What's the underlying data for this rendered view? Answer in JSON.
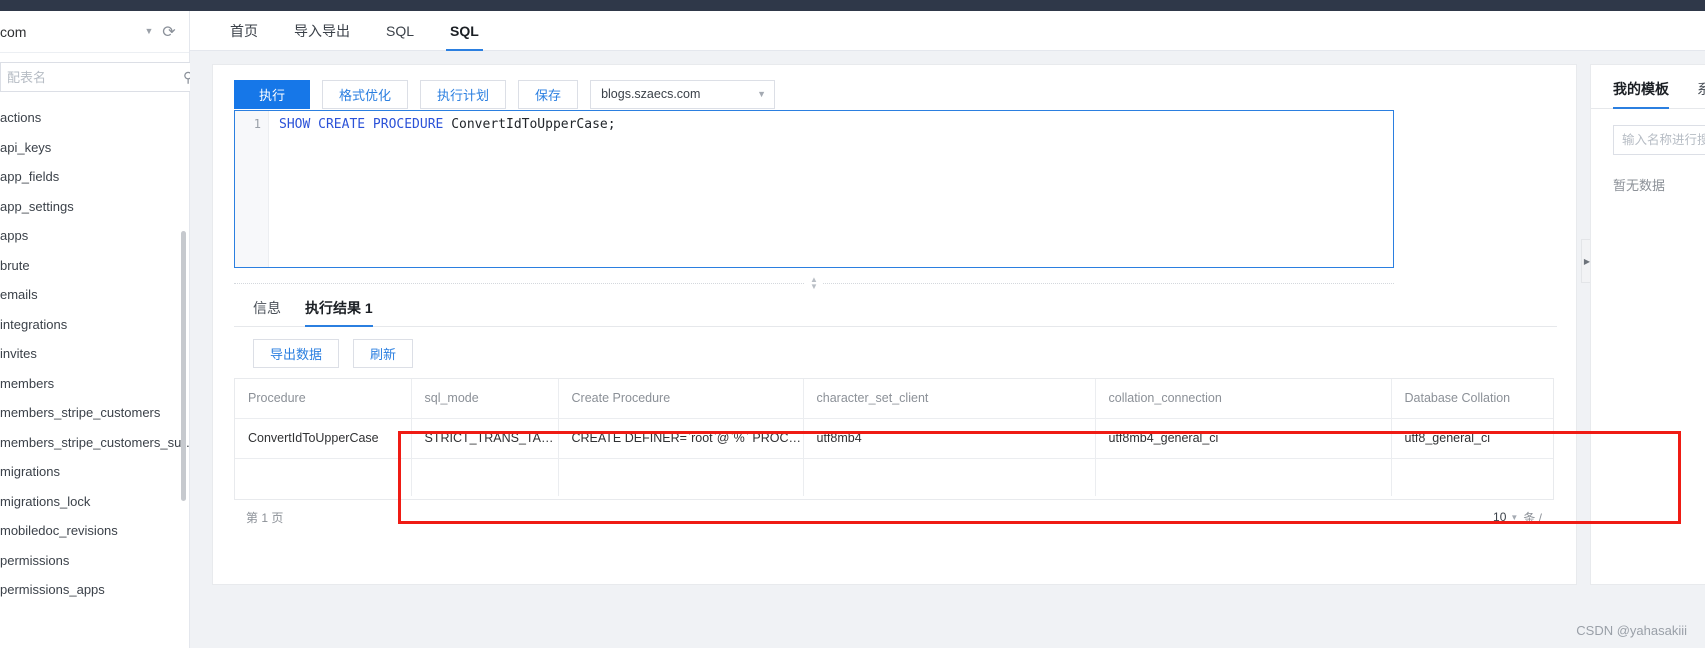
{
  "sidebar": {
    "connection_name": "com",
    "caret_icon": "chevron-down-icon",
    "refresh_icon": "refresh-icon",
    "search_placeholder": "配表名",
    "search_value": "",
    "search_icon": "search-icon",
    "add_label": "+",
    "tables": [
      "actions",
      "api_keys",
      "app_fields",
      "app_settings",
      "apps",
      "brute",
      "emails",
      "integrations",
      "invites",
      "members",
      "members_stripe_customers",
      "members_stripe_customers_su…",
      "migrations",
      "migrations_lock",
      "mobiledoc_revisions",
      "permissions",
      "permissions_apps"
    ]
  },
  "tabs": [
    {
      "label": "首页",
      "active": false
    },
    {
      "label": "导入导出",
      "active": false
    },
    {
      "label": "SQL",
      "active": false
    },
    {
      "label": "SQL",
      "active": true
    }
  ],
  "toolbar": {
    "execute_label": "执行",
    "format_label": "格式优化",
    "plan_label": "执行计划",
    "save_label": "保存",
    "database_value": "blogs.szaecs.com",
    "database_caret_icon": "chevron-down-icon"
  },
  "editor": {
    "line_number": "1",
    "sql_keywords": "SHOW CREATE PROCEDURE",
    "sql_rest": " ConvertIdToUpperCase;"
  },
  "result_tabs": [
    {
      "label": "信息",
      "active": false
    },
    {
      "label": "执行结果 1",
      "active": true
    }
  ],
  "result_toolbar": {
    "export_label": "导出数据",
    "refresh_label": "刷新"
  },
  "table": {
    "columns": [
      "Procedure",
      "sql_mode",
      "Create Procedure",
      "character_set_client",
      "collation_connection",
      "Database Collation"
    ],
    "rows": [
      [
        "ConvertIdToUpperCase",
        "STRICT_TRANS_TABL…",
        "CREATE DEFINER=`root`@`%` PROCEDU…",
        "utf8mb4",
        "utf8mb4_general_ci",
        "utf8_general_ci"
      ]
    ]
  },
  "pager": {
    "page_text": "第 1 页",
    "page_size": "10",
    "page_size_caret_icon": "chevron-down-icon",
    "per_page_suffix": "条 /"
  },
  "template_panel": {
    "tabs": [
      {
        "label": "我的模板",
        "active": true
      },
      {
        "label": "系统模板",
        "active": false
      }
    ],
    "search_placeholder": "输入名称进行搜索",
    "search_value": "",
    "empty_text": "暂无数据",
    "collapse_icon": "triangle-right-icon"
  },
  "watermark": "CSDN @yahasakiii",
  "colors": {
    "primary": "#1677e8",
    "tab_underline": "#2b7fe0",
    "highlight_box": "#ef1b14",
    "topbar_dark": "#2f3849"
  }
}
